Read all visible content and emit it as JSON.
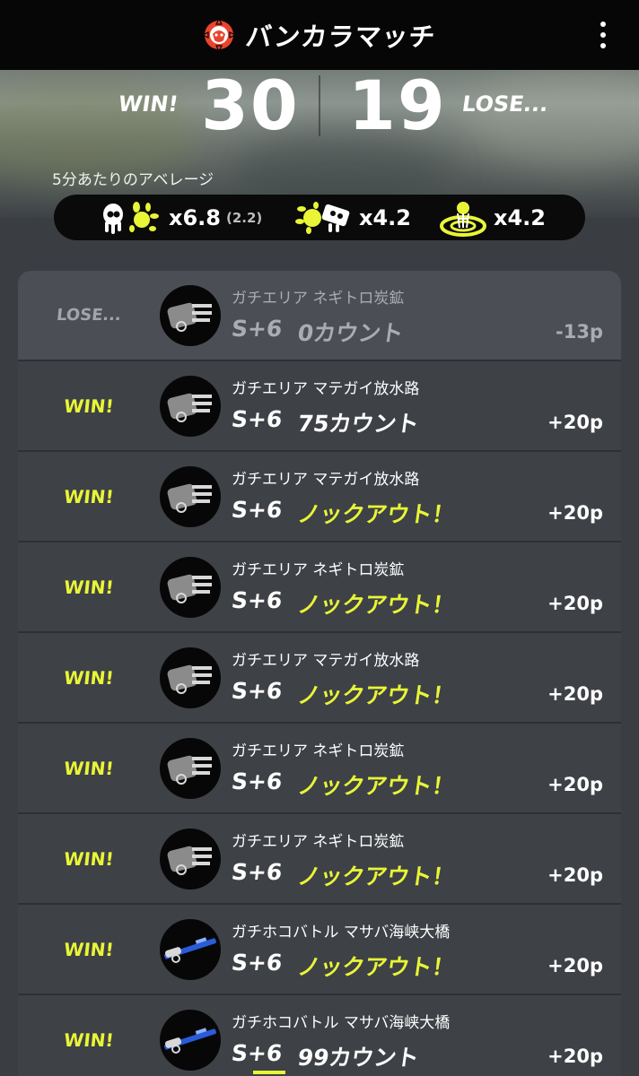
{
  "header": {
    "mode_title": "バンカラマッチ",
    "mode_icon": "bankara-emblem-icon",
    "menu_icon": "kebab-menu-icon",
    "accent_color": "#e9f536",
    "brand_color": "#e8452e"
  },
  "summary": {
    "win_label": "WIN!",
    "lose_label": "LOSE...",
    "wins": "30",
    "losses": "19",
    "average_label": "5分あたりのアベレージ",
    "kill_assist": "x6.8",
    "assist": "(2.2)",
    "special": "x4.2",
    "paint": "x4.2"
  },
  "battles": [
    {
      "result": "LOSE...",
      "stage": "ガチエリア ネギトロ炭鉱",
      "rank": "S+6",
      "detail": "0カウント",
      "knockout": false,
      "points": "-13p",
      "weapon": "gray-blaster"
    },
    {
      "result": "WIN!",
      "stage": "ガチエリア マテガイ放水路",
      "rank": "S+6",
      "detail": "75カウント",
      "knockout": false,
      "points": "+20p",
      "weapon": "gray-blaster"
    },
    {
      "result": "WIN!",
      "stage": "ガチエリア マテガイ放水路",
      "rank": "S+6",
      "detail": "ノックアウト！",
      "knockout": true,
      "points": "+20p",
      "weapon": "gray-blaster"
    },
    {
      "result": "WIN!",
      "stage": "ガチエリア ネギトロ炭鉱",
      "rank": "S+6",
      "detail": "ノックアウト！",
      "knockout": true,
      "points": "+20p",
      "weapon": "gray-blaster"
    },
    {
      "result": "WIN!",
      "stage": "ガチエリア マテガイ放水路",
      "rank": "S+6",
      "detail": "ノックアウト！",
      "knockout": true,
      "points": "+20p",
      "weapon": "gray-blaster"
    },
    {
      "result": "WIN!",
      "stage": "ガチエリア ネギトロ炭鉱",
      "rank": "S+6",
      "detail": "ノックアウト！",
      "knockout": true,
      "points": "+20p",
      "weapon": "gray-blaster"
    },
    {
      "result": "WIN!",
      "stage": "ガチエリア ネギトロ炭鉱",
      "rank": "S+6",
      "detail": "ノックアウト！",
      "knockout": true,
      "points": "+20p",
      "weapon": "gray-blaster"
    },
    {
      "result": "WIN!",
      "stage": "ガチホコバトル マサバ海峡大橋",
      "rank": "S+6",
      "detail": "ノックアウト！",
      "knockout": true,
      "points": "+20p",
      "weapon": "blue-charger"
    },
    {
      "result": "WIN!",
      "stage": "ガチホコバトル マサバ海峡大橋",
      "rank": "S+6",
      "detail": "99カウント",
      "knockout": false,
      "points": "+20p",
      "weapon": "blue-charger"
    }
  ]
}
